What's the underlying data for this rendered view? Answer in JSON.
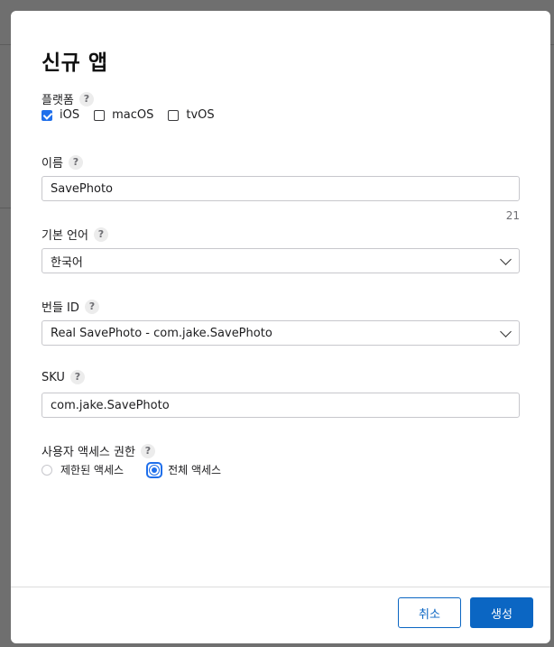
{
  "dialog": {
    "title": "신규 앱",
    "platform_label": "플랫폼",
    "platforms": [
      {
        "label": "iOS",
        "checked": true
      },
      {
        "label": "macOS",
        "checked": false
      },
      {
        "label": "tvOS",
        "checked": false
      }
    ],
    "name_label": "이름",
    "name_value": "SavePhoto",
    "name_counter": "21",
    "language_label": "기본 언어",
    "language_value": "한국어",
    "bundle_label": "번들 ID",
    "bundle_value": "Real SavePhoto - com.jake.SavePhoto",
    "sku_label": "SKU",
    "sku_value": "com.jake.SavePhoto",
    "access_label": "사용자 액세스 권한",
    "access_options": [
      {
        "label": "제한된 액세스",
        "selected": false
      },
      {
        "label": "전체 액세스",
        "selected": true
      }
    ],
    "help_glyph": "?",
    "cancel_label": "취소",
    "create_label": "생성"
  },
  "colors": {
    "accent": "#0b66c3",
    "overlay": "#6f6f6f"
  }
}
